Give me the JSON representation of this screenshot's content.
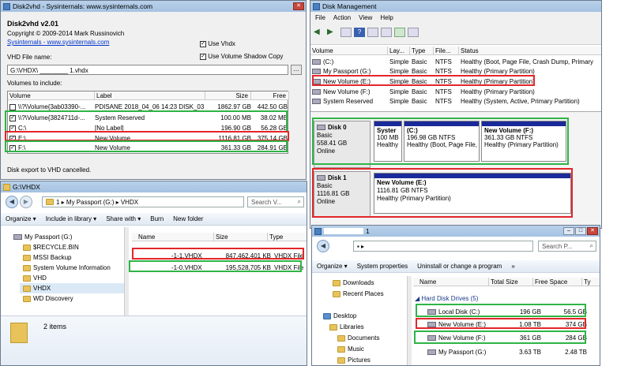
{
  "disk2vhd": {
    "title": "Disk2vhd - Sysinternals: www.sysinternals.com",
    "app_name": "Disk2vhd v2.01",
    "copyright": "Copyright © 2009-2014 Mark Russinovich",
    "link": "Sysinternals - www.sysinternals.com",
    "use_vhdx_label": "Use Vhdx",
    "use_vss_label": "Use Volume Shadow Copy",
    "vhd_file_label": "VHD File name:",
    "vhd_file_value": "G:\\VHDX\\ ________ 1.vhdx",
    "volumes_label": "Volumes to include:",
    "columns": [
      "Volume",
      "Label",
      "Size",
      "Free"
    ],
    "rows": [
      {
        "checked": false,
        "volume": "\\\\?\\Volume{3ab03390-...",
        "label": "PDISANE 2018_04_06 14:23 DISK_03",
        "size": "1862.97 GB",
        "free": "442.50 GB"
      },
      {
        "checked": true,
        "volume": "\\\\?\\Volume{3824711d-...",
        "label": "System Reserved",
        "size": "100.00 MB",
        "free": "38.02 MB"
      },
      {
        "checked": true,
        "volume": "C:\\",
        "label": "[No Label]",
        "size": "196.90 GB",
        "free": "56.28 GB"
      },
      {
        "checked": true,
        "volume": "E:\\",
        "label": "New Volume",
        "size": "1116.81 GB",
        "free": "375.14 GB"
      },
      {
        "checked": true,
        "volume": "F:\\",
        "label": "New Volume",
        "size": "361.33 GB",
        "free": "284.91 GB"
      }
    ],
    "status": "Disk export to VHD cancelled."
  },
  "diskmgmt": {
    "title": "Disk Management",
    "menu": [
      "File",
      "Action",
      "View",
      "Help"
    ],
    "columns": [
      "Volume",
      "Lay...",
      "Type",
      "File...",
      "Status"
    ],
    "rows": [
      {
        "volume": "(C:)",
        "layout": "Simple",
        "type": "Basic",
        "fs": "NTFS",
        "status": "Healthy (Boot, Page File, Crash Dump, Primary"
      },
      {
        "volume": "My Passport (G:)",
        "layout": "Simple",
        "type": "Basic",
        "fs": "NTFS",
        "status": "Healthy (Primary Partition)"
      },
      {
        "volume": "New Volume (E:)",
        "layout": "Simple",
        "type": "Basic",
        "fs": "NTFS",
        "status": "Healthy (Primary Partition)"
      },
      {
        "volume": "New Volume (F:)",
        "layout": "Simple",
        "type": "Basic",
        "fs": "NTFS",
        "status": "Healthy (Primary Partition)"
      },
      {
        "volume": "System Reserved",
        "layout": "Simple",
        "type": "Basic",
        "fs": "NTFS",
        "status": "Healthy (System, Active, Primary Partition)"
      }
    ],
    "disk0": {
      "name": "Disk 0",
      "type": "Basic",
      "size": "558.41 GB",
      "state": "Online",
      "volumes": [
        {
          "name": "Syster",
          "l1": "100 MB",
          "l2": "Healthy"
        },
        {
          "name": "(C:)",
          "l1": "196.98 GB NTFS",
          "l2": "Healthy (Boot, Page File,"
        },
        {
          "name": "New Volume  (F:)",
          "l1": "361.33 GB NTFS",
          "l2": "Healthy (Primary Partition)"
        }
      ]
    },
    "disk1": {
      "name": "Disk 1",
      "type": "Basic",
      "size": "1116.81 GB",
      "state": "Online",
      "volume": {
        "name": "New Volume  (E:)",
        "l1": "1116.81 GB NTFS",
        "l2": "Healthy (Primary Partition)"
      }
    }
  },
  "explorer_left": {
    "title": "G:\\VHDX",
    "address": "1 ▸ My Passport (G:) ▸ VHDX",
    "search_placeholder": "Search V...",
    "commands": [
      "Organize ▾",
      "Include in library ▾",
      "Share with ▾",
      "Burn",
      "New folder"
    ],
    "tree": [
      "My Passport (G:)",
      "$RECYCLE.BIN",
      "MSSI Backup",
      "System Volume Information",
      "VHD",
      "VHDX",
      "WD Discovery"
    ],
    "columns": [
      "Name",
      "Size",
      "Type"
    ],
    "files": [
      {
        "name": "-1-1.VHDX",
        "size": "847,462,401 KB",
        "type": "VHDX File"
      },
      {
        "name": "-1-0.VHDX",
        "size": "195,528,705 KB",
        "type": "VHDX File"
      }
    ],
    "status": "2 items"
  },
  "explorer_right": {
    "title": "1",
    "search_placeholder": "Search P...",
    "commands": [
      "Organize ▾",
      "System properties",
      "Uninstall or change a program",
      "»"
    ],
    "nav": [
      "Downloads",
      "Recent Places",
      "Desktop",
      "Libraries",
      "Documents",
      "Music",
      "Pictures"
    ],
    "columns": [
      "Name",
      "Total Size",
      "Free Space",
      "Ty"
    ],
    "group": "Hard Disk Drives (5)",
    "drives": [
      {
        "name": "Local Disk (C:)",
        "total": "196 GB",
        "free": "56.5 GB"
      },
      {
        "name": "New Volume (E:)",
        "total": "1.08 TB",
        "free": "374 GB"
      },
      {
        "name": "New Volume (F:)",
        "total": "361 GB",
        "free": "284 GB"
      },
      {
        "name": "My Passport (G:)",
        "total": "3.63 TB",
        "free": "2.48 TB"
      }
    ]
  }
}
